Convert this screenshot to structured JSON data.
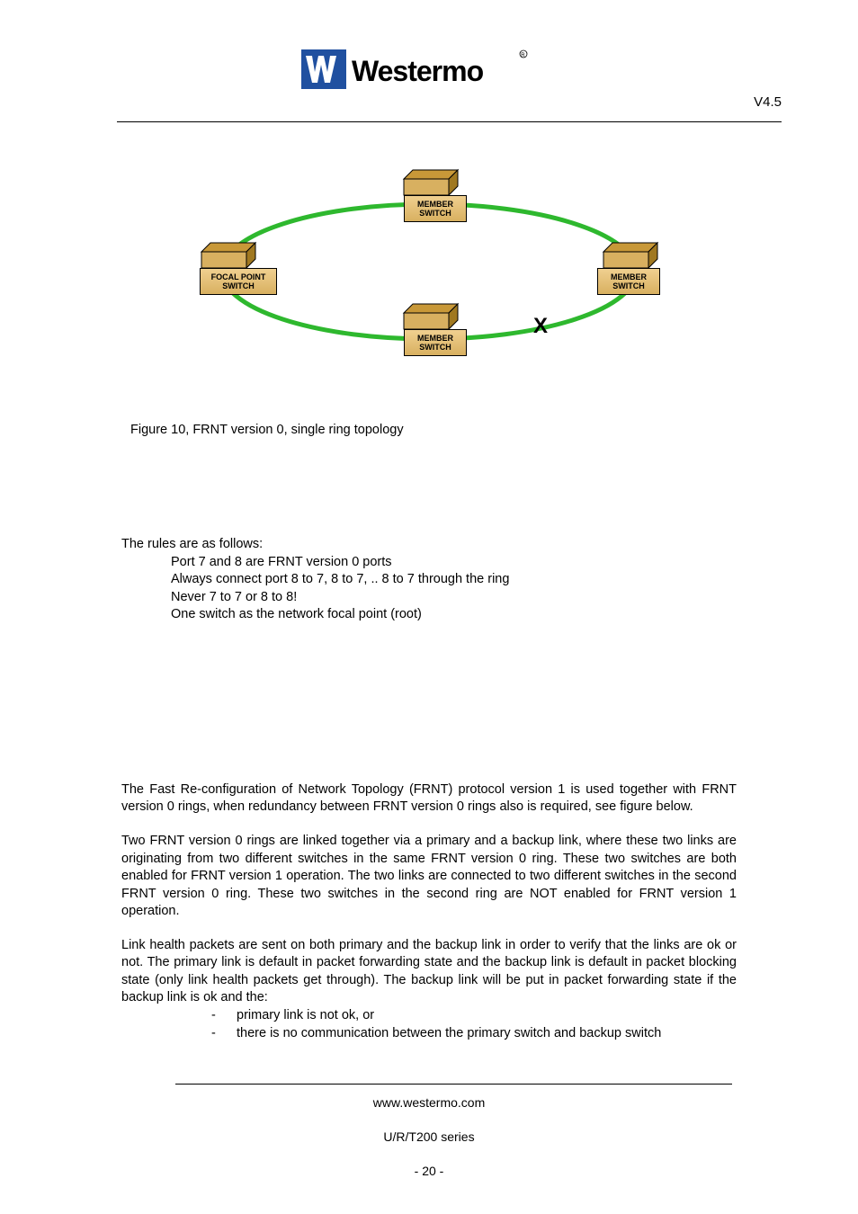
{
  "header": {
    "brand": "westermo",
    "version": "V4.5"
  },
  "diagram": {
    "nodes": {
      "top": {
        "line1": "MEMBER",
        "line2": "SWITCH"
      },
      "left": {
        "line1": "FOCAL POINT",
        "line2": "SWITCH"
      },
      "right": {
        "line1": "MEMBER",
        "line2": "SWITCH"
      },
      "bottom": {
        "line1": "MEMBER",
        "line2": "SWITCH"
      }
    },
    "break_mark": "X"
  },
  "figure_caption": "Figure 10, FRNT version 0, single ring topology",
  "rules": {
    "intro": "The rules are as follows:",
    "items": [
      "Port 7 and 8 are FRNT version 0 ports",
      "Always connect port 8 to 7, 8 to 7, .. 8 to 7 through the ring",
      "Never 7 to 7 or 8 to 8!",
      "One switch as the network focal point (root)"
    ]
  },
  "paragraphs": {
    "p1": "The Fast Re-configuration of Network Topology (FRNT) protocol version 1 is used together with FRNT version 0 rings, when redundancy between FRNT version 0 rings also is required, see figure below.",
    "p2": "Two FRNT version 0 rings are linked together via a primary and a backup link, where these two links are originating from two different switches in the same FRNT version 0 ring.  These two switches are both enabled for FRNT version 1 operation. The two links are connected to two different switches in the second FRNT version 0 ring. These two switches in the second ring are NOT enabled for FRNT version 1 operation.",
    "p3": "Link health packets are sent on both primary and the backup link in order to verify that the links are ok or not.  The primary link is default in packet forwarding state and the backup link is default in packet blocking state (only link health packets get through).  The backup link will be put in packet forwarding state if the backup link is ok and the:",
    "bullets": [
      "primary link is not ok, or",
      "there is no communication between the primary switch and backup switch"
    ]
  },
  "footer": {
    "url": "www.westermo.com",
    "series": "U/R/T200 series",
    "page": "- 20 -"
  }
}
